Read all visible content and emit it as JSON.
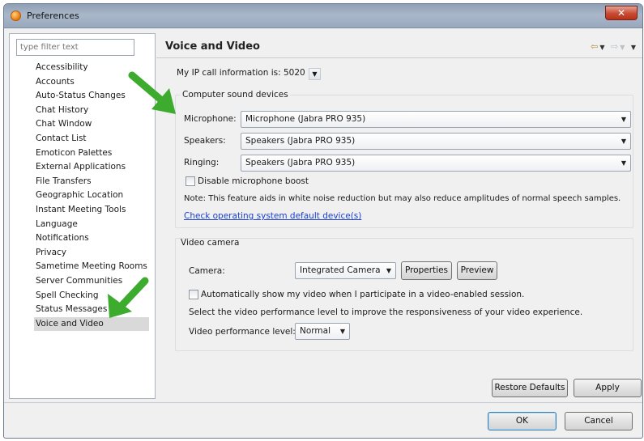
{
  "window": {
    "title": "Preferences",
    "close_glyph": "✕"
  },
  "sidebar": {
    "filter_placeholder": "type filter text",
    "items": [
      "Accessibility",
      "Accounts",
      "Auto-Status Changes",
      "Chat History",
      "Chat Window",
      "Contact List",
      "Emoticon Palettes",
      "External Applications",
      "File Transfers",
      "Geographic Location",
      "Instant Meeting Tools",
      "Language",
      "Notifications",
      "Privacy",
      "Sametime Meeting Rooms",
      "Server Communities",
      "Spell Checking",
      "Status Messages",
      "Voice and Video"
    ],
    "selected_index": 18
  },
  "panel": {
    "title": "Voice and Video",
    "ip_label": "My IP call information is: 5020",
    "sound": {
      "group_title": "Computer sound devices",
      "microphone_label": "Microphone:",
      "microphone_value": "Microphone (Jabra PRO 935)",
      "speakers_label": "Speakers:",
      "speakers_value": "Speakers (Jabra PRO 935)",
      "ringing_label": "Ringing:",
      "ringing_value": "Speakers (Jabra PRO 935)",
      "disable_boost_label": "Disable microphone boost",
      "note": "Note: This feature aids in white noise reduction but may also reduce amplitudes of normal speech samples.",
      "check_link": "Check operating system default device(s)"
    },
    "video": {
      "group_title": "Video camera",
      "camera_label": "Camera:",
      "camera_value": "Integrated Camera",
      "properties_label": "Properties",
      "preview_label": "Preview",
      "auto_show_label": "Automatically show my video when I participate in a video-enabled session.",
      "performance_hint": "Select the video performance level to improve the responsiveness of your video experience.",
      "performance_label": "Video performance level:",
      "performance_value": "Normal"
    },
    "restore_defaults_label": "Restore Defaults",
    "apply_label": "Apply"
  },
  "footer": {
    "ok_label": "OK",
    "cancel_label": "Cancel"
  },
  "icons": {
    "app": "sametime-app-icon",
    "back": "back-arrow-icon",
    "forward": "forward-arrow-icon",
    "menu": "view-menu-icon",
    "dropdown": "chevron-down-icon",
    "annotation": "green-arrow-icon"
  },
  "colors": {
    "annotation_arrow": "#3dab2e",
    "link": "#1a3fcf",
    "selection": "#d9d9d9"
  }
}
